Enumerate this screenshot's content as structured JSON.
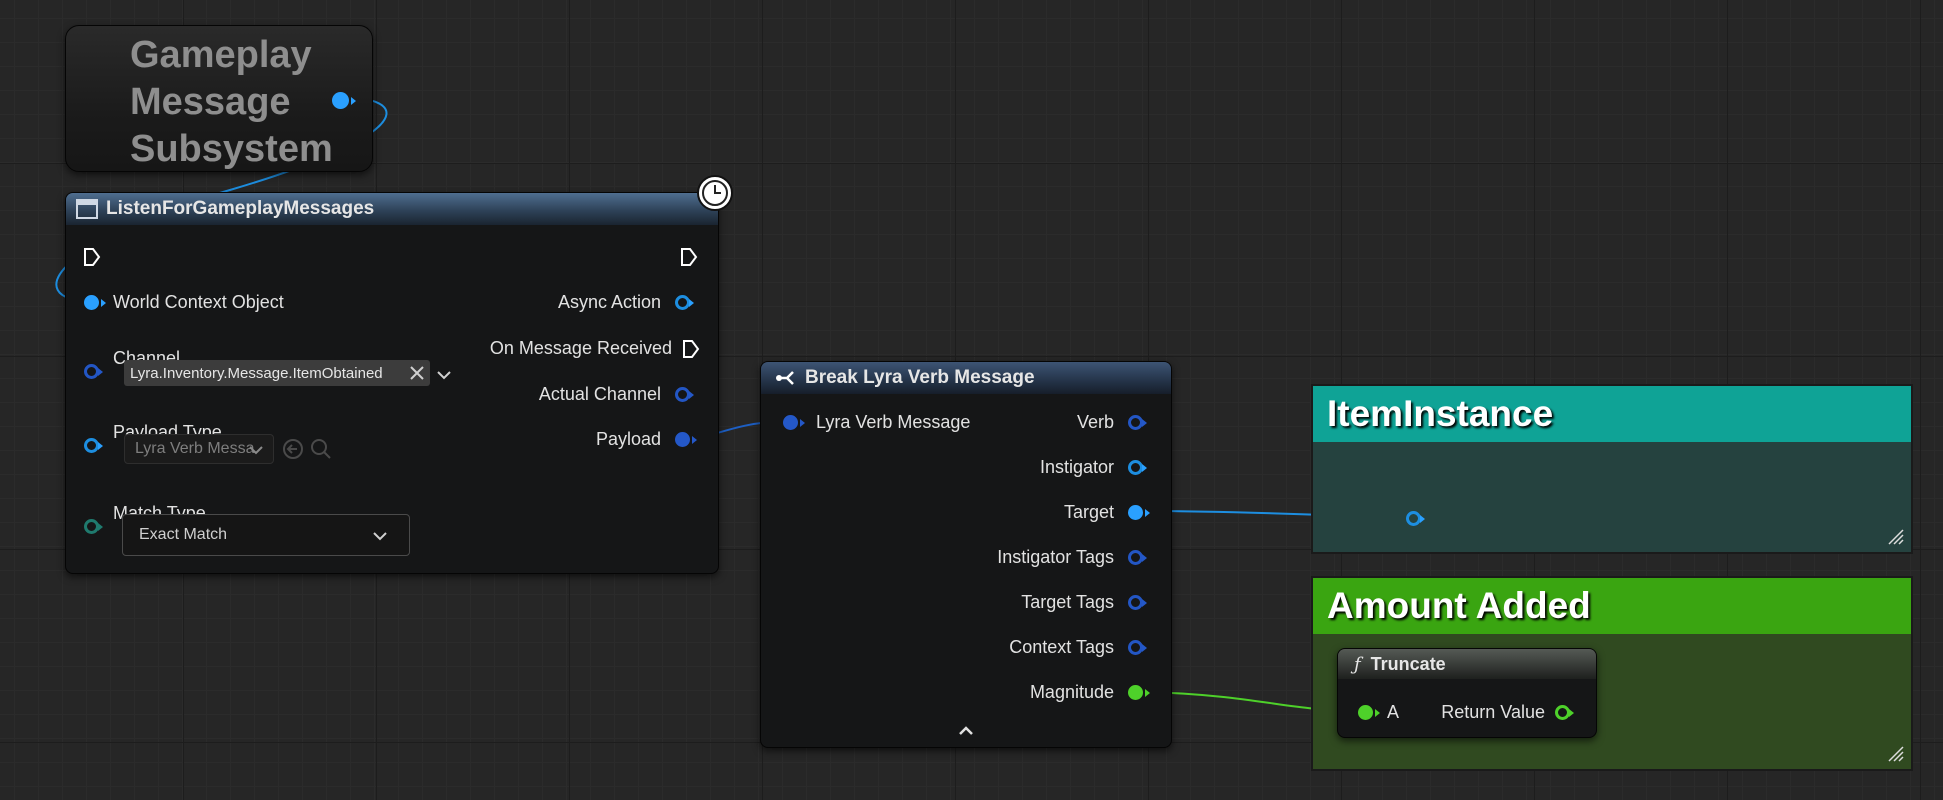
{
  "subsystem_node": {
    "title": "Gameplay\nMessage\nSubsystem"
  },
  "listen_node": {
    "title": "ListenForGameplayMessages",
    "world_context_label": "World Context Object",
    "channel_label": "Channel",
    "channel_value": "Lyra.Inventory.Message.ItemObtained",
    "payload_type_label": "Payload Type",
    "payload_type_value": "Lyra Verb Messa",
    "match_type_label": "Match Type",
    "match_type_value": "Exact Match",
    "outputs": [
      "Async Action",
      "On Message Received",
      "Actual Channel",
      "Payload"
    ]
  },
  "break_node": {
    "title": "Break Lyra Verb Message",
    "input_label": "Lyra Verb Message",
    "outputs": [
      "Verb",
      "Instigator",
      "Target",
      "Instigator Tags",
      "Target Tags",
      "Context Tags",
      "Magnitude"
    ]
  },
  "comments": {
    "item_instance": {
      "title": "ItemInstance",
      "color": "#0fa396"
    },
    "amount_added": {
      "title": "Amount Added",
      "color": "#3aa511"
    }
  },
  "truncate_node": {
    "title": "Truncate",
    "input_label": "A",
    "output_label": "Return Value"
  },
  "colors": {
    "object_pin": "#2aa0ff",
    "struct_pin": "#2458c8",
    "float_pin": "#4ed12a",
    "exec_pin": "#ffffff"
  },
  "icons": [
    "clock-icon",
    "function-icon",
    "break-icon",
    "collapse-chevron-icon",
    "search-icon",
    "back-arrow-icon",
    "clear-x-icon",
    "chevron-down-icon",
    "resize-grip-icon"
  ]
}
